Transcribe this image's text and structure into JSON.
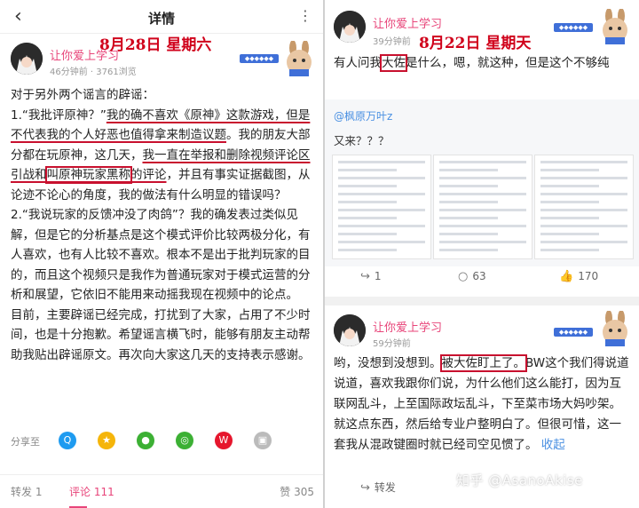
{
  "left": {
    "back_glyph": "‹",
    "title": "详情",
    "more_glyph": "⋮",
    "user": {
      "name": "让你爱上学习",
      "meta": "46分钟前 · 3761浏览"
    },
    "date_note": "8月28日 星期六",
    "badge_text": "◆◆◆◆◆◆",
    "body": {
      "intro": "对于另外两个谣言的辟谣：",
      "p1a": "1.“我批评原神？”",
      "p1b": "我的确不喜欢《原神》这款游戏，但是",
      "p1c": "不代表我的个人好恶也值得拿来制造议题",
      "p1d": "。我的朋友大部分都在玩原神，这几天，",
      "p1e": "我一直在举报和删除视频评论区引战和",
      "p1f": "叫原神玩家黑称",
      "p1g": "的评论",
      "p1h": "，并且有事实证据截图，从论迹不论心的角度，我的做法有什么明显的错误吗？",
      "p2": "2.“我说玩家的反馈冲没了肉鸽”？我的确发表过类似见解，但是它的分析基点是这个模式评价比较两极分化，有人喜欢，也有人比较不喜欢。根本不是出于批判玩家的目的，而且这个视频只是我作为普通玩家对于模式运营的分析和展望，它依旧不能用来动摇我现在视频中的论点。",
      "p3": "目前，主要辟谣已经完成，打扰到了大家，占用了不少时间，也是十分抱歉。希望谣言横飞时，能够有朋友主动帮助我贴出辟谣原文。再次向大家这几天的支持表示感谢。"
    },
    "share_label": "分享至",
    "share_icons": [
      "qq-icon",
      "qzone-icon",
      "wechat-icon",
      "moments-icon",
      "weibo-icon",
      "image-icon"
    ],
    "tabs": {
      "forward": "转发 1",
      "comment": "评论 111",
      "like": "赞 305"
    }
  },
  "right": {
    "top": {
      "user": {
        "name": "让你爱上学习",
        "meta": "39分钟前"
      },
      "date_note": "8月22日 星期天",
      "text_a": "有人问我",
      "text_boxed": "大佐",
      "text_b": "是什么，嗯，就这种，但是这个不够纯",
      "mention": "@枫原万叶z",
      "repost": "又来？？？",
      "actions": {
        "forward": "1",
        "comment": "63",
        "like": "170"
      }
    },
    "bottom": {
      "user": {
        "name": "让你爱上学习",
        "meta": "59分钟前"
      },
      "text_a": "哟，没想到没想到。",
      "text_boxed": "被大佐盯上了。",
      "text_b": "BW这个我们得说道说道，喜欢我跟你们说，为什么他们这么能打，因为互联网乱斗，上至国际政坛乱斗，下至菜市场大妈吵架。就这点东西，然后给专业户整明白了。但很可惜，这一套我从混政键圈时就已经司空见惯了。",
      "fold": "收起",
      "forward": "转发"
    },
    "watermark": "知乎 @AsanoAkise"
  },
  "colors": {
    "accent_pink": "#e8457a",
    "annotation_red": "#c8102e",
    "link_blue": "#4a90e2"
  }
}
